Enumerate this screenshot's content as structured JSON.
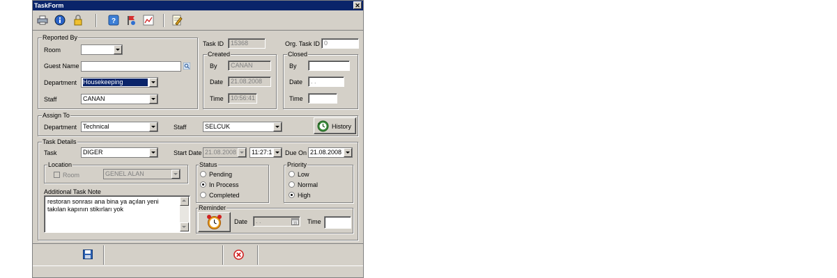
{
  "window": {
    "title": "TaskForm",
    "close": "✕"
  },
  "toolbar": {
    "icons": [
      "printer-icon",
      "info-icon",
      "lock-icon",
      "help-icon",
      "flag-icon",
      "chart-icon",
      "edit-note-icon"
    ]
  },
  "reported_by": {
    "legend": "Reported By",
    "room_label": "Room",
    "room_value": "",
    "guest_name_label": "Guest Name",
    "guest_name_value": "",
    "department_label": "Department",
    "department_value": "Housekeeping",
    "staff_label": "Staff",
    "staff_value": "CANAN"
  },
  "task_info": {
    "task_id_label": "Task ID",
    "task_id_value": "15368",
    "org_task_id_label": "Org. Task ID",
    "org_task_id_value": "0"
  },
  "created": {
    "legend": "Created",
    "by_label": "By",
    "by_value": "CANAN",
    "date_label": "Date",
    "date_value": "21.08.2008",
    "time_label": "Time",
    "time_value": "10:56:41"
  },
  "closed": {
    "legend": "Closed",
    "by_label": "By",
    "by_value": "",
    "date_label": "Date",
    "date_value": " . .",
    "time_label": "Time",
    "time_value": ""
  },
  "assign_to": {
    "legend": "Assign To",
    "department_label": "Department",
    "department_value": "Technical",
    "staff_label": "Staff",
    "staff_value": "SELCUK",
    "history_button": "History"
  },
  "task_details": {
    "legend": "Task Details",
    "task_label": "Task",
    "task_value": "DIGER",
    "start_date_label": "Start Date",
    "start_date_value": "21.08.2008",
    "start_time_value": "11:27:1",
    "due_on_label": "Due On",
    "due_on_value": "21.08.2008"
  },
  "location": {
    "legend": "Location",
    "room_label": "Room",
    "area_value": "GENEL ALAN"
  },
  "status": {
    "legend": "Status",
    "options": [
      "Pending",
      "In Process",
      "Completed"
    ],
    "selected": "In Process"
  },
  "priority": {
    "legend": "Priority",
    "options": [
      "Low",
      "Normal",
      "High"
    ],
    "selected": "High"
  },
  "note": {
    "label": "Additional Task Note",
    "text": "restoran sonrası ana bina ya açılan yeni takılan kapının stikırları yok"
  },
  "reminder": {
    "legend": "Reminder",
    "date_label": "Date",
    "date_value": " . .",
    "time_label": "Time",
    "time_value": ""
  },
  "colors": {
    "window_bg": "#d4d0c8",
    "titlebar": "#0a246a",
    "selection": "#0a246a"
  }
}
